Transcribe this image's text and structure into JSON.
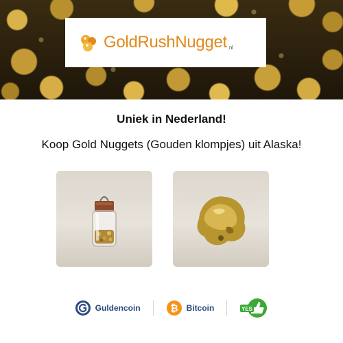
{
  "logo": {
    "name": "GoldRushNugget",
    "tld": ".nl"
  },
  "headline": "Uniek in Nederland!",
  "subline": "Koop Gold Nuggets  (Gouden klompjes) uit Alaska!",
  "products": [
    {
      "icon": "gold-flakes-vial-image"
    },
    {
      "icon": "gold-nugget-image"
    }
  ],
  "payments": [
    {
      "label": "Guldencoin",
      "icon": "guldencoin-icon"
    },
    {
      "label": "Bitcoin",
      "icon": "bitcoin-icon"
    },
    {
      "label": "YES",
      "icon": "yes-thumbs-up-icon"
    }
  ],
  "colors": {
    "brand_orange": "#e08a1e",
    "text": "#111111",
    "payment_text": "#2a4a7f",
    "bitcoin_orange": "#f7931a",
    "yes_green": "#3aa935"
  }
}
